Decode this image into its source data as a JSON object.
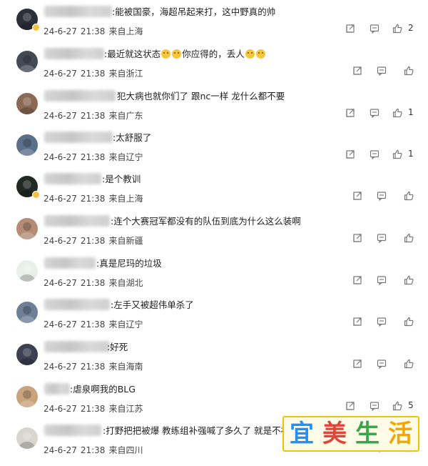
{
  "comments": [
    {
      "text": ":能被国豪，海超吊起来打，这中野真的帅",
      "date": "24-6-27",
      "time": "21:38",
      "location": "来自上海",
      "likes": "2",
      "avatar_color": "#2b2f3a"
    },
    {
      "text": ":最近就这状态",
      "text2": "你应得的，丢人",
      "date": "24-6-27",
      "time": "21:38",
      "location": "来自浙江",
      "likes": "",
      "avatar_color": "#444a55"
    },
    {
      "text": "犯大病也就你们了 跟nc一样 龙什么都不要",
      "date": "24-6-27",
      "time": "21:38",
      "location": "来自广东",
      "likes": "1",
      "avatar_color": "#8b6a55"
    },
    {
      "text": ":太舒服了",
      "date": "24-6-27",
      "time": "21:38",
      "location": "来自辽宁",
      "likes": "1",
      "avatar_color": "#5a6f8a"
    },
    {
      "text": ":是个教训",
      "date": "24-6-27",
      "time": "21:38",
      "location": "来自上海",
      "likes": "",
      "avatar_color": "#1f2a24"
    },
    {
      "text": ":连个大赛冠军都没有的队伍到底为什么这么装啊",
      "date": "24-6-27",
      "time": "21:38",
      "location": "来自新疆",
      "likes": "",
      "avatar_color": "#b58c76"
    },
    {
      "text": ":真是尼玛的垃圾",
      "date": "24-6-27",
      "time": "21:38",
      "location": "来自湖北",
      "likes": "",
      "avatar_color": "#e9f0ea"
    },
    {
      "text": ":左手又被超伟单杀了",
      "date": "24-6-27",
      "time": "21:38",
      "location": "来自辽宁",
      "likes": "",
      "avatar_color": "#6e7f96"
    },
    {
      "text": ":好死",
      "date": "24-6-27",
      "time": "21:38",
      "location": "来自海南",
      "likes": "",
      "avatar_color": "#3d3f52"
    },
    {
      "text": ":虐泉啊我的BLG",
      "date": "24-6-27",
      "time": "21:38",
      "location": "来自江苏",
      "likes": "5",
      "avatar_color": "#c9a37c"
    },
    {
      "text": ":打野把把被爆 教练组补强喊了多久了 就是不补",
      "date": "24-6-27",
      "time": "21:38",
      "location": "来自四川",
      "likes": "",
      "avatar_color": "#d9d6d0"
    }
  ],
  "icons": {
    "share": "share-icon",
    "reply": "comment-icon",
    "like": "thumbs-up-icon"
  },
  "watermark": {
    "chars": [
      "宜",
      "美",
      "生",
      "活"
    ],
    "colors": [
      "#1e90ff",
      "#e0453a",
      "#3aa64c",
      "#f0a800"
    ]
  }
}
